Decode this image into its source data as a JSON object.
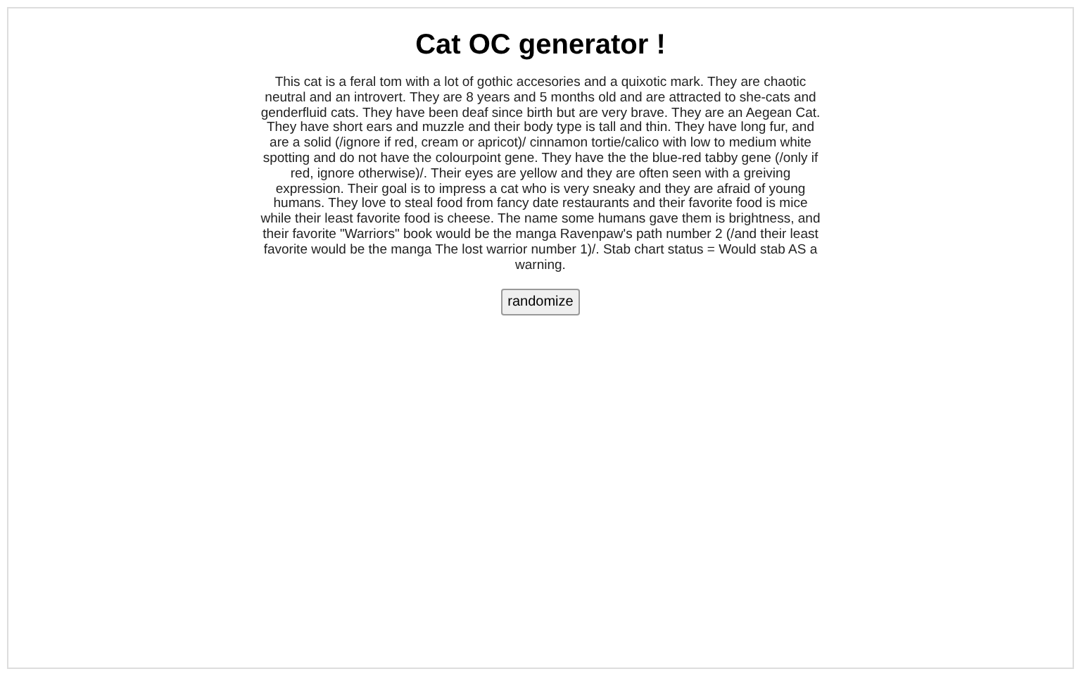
{
  "title": "Cat OC generator !",
  "description": "This cat is a feral tom with a lot of gothic accesories and a quixotic mark. They are chaotic neutral and an introvert. They are 8 years and 5 months old and are attracted to she-cats and genderfluid cats. They have been deaf since birth but are very brave. They are an Aegean Cat. They have short ears and muzzle and their body type is tall and thin. They have long fur, and are a solid (/ignore if red, cream or apricot)/ cinnamon tortie/calico with low to medium white spotting and do not have the colourpoint gene. They have the the blue-red tabby gene (/only if red, ignore otherwise)/. Their eyes are yellow and they are often seen with a greiving expression. Their goal is to impress a cat who is very sneaky and they are afraid of young humans. They love to steal food from fancy date restaurants and their favorite food is mice while their least favorite food is cheese. The name some humans gave them is brightness, and their favorite \"Warriors\" book would be the manga Ravenpaw's path number 2 (/and their least favorite would be the manga The lost warrior number 1)/. Stab chart status = Would stab AS a warning.",
  "button": "randomize"
}
